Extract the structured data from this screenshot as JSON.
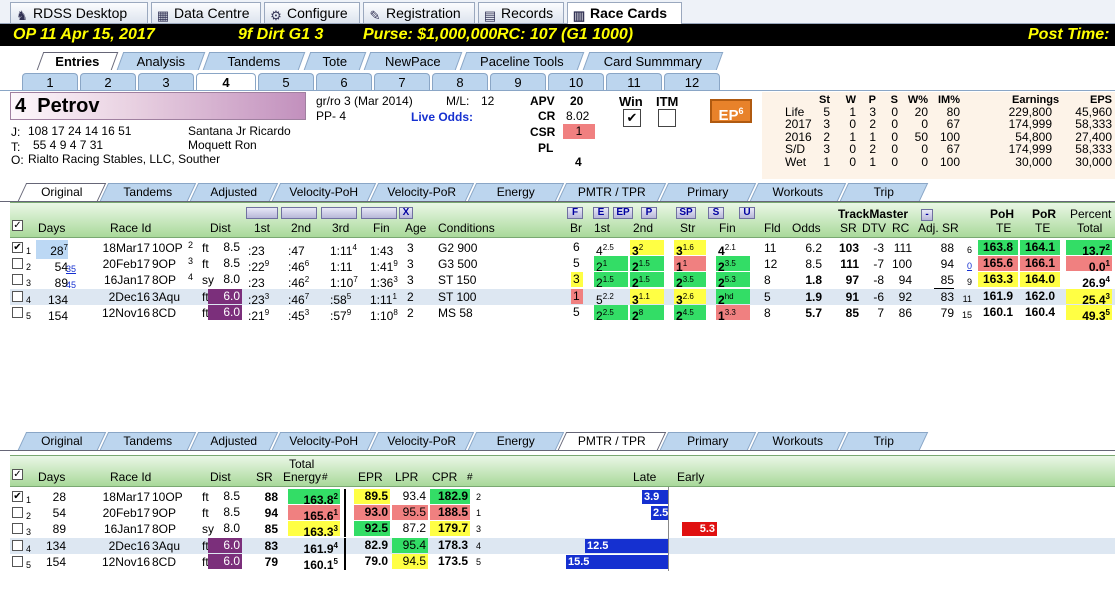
{
  "app_tabs": [
    "RDSS Desktop",
    "Data Centre",
    "Configure",
    "Registration",
    "Records",
    "Race Cards"
  ],
  "app_tab_icons": [
    "horse-icon",
    "grid-icon",
    "gear-icon",
    "key-icon",
    "table-icon",
    "book-icon"
  ],
  "race_header": {
    "race": "OP  11   Apr 15, 2017",
    "info": "9f  Dirt   G1  3",
    "purse": "Purse: $1,000,000",
    "rc": "RC: 107  (G1 1000)",
    "post": "Post Time:"
  },
  "entry_tabs": [
    "Entries",
    "Analysis",
    "Tandems",
    "Tote",
    "NewPace",
    "Paceline Tools",
    "Card Summmary"
  ],
  "post_tabs": [
    "1",
    "2",
    "3",
    "4",
    "5",
    "6",
    "7",
    "8",
    "9",
    "10",
    "11",
    "12"
  ],
  "horse": {
    "post": "4",
    "name": "Petrov",
    "breeding": "gr/ro  3  (Mar 2014)",
    "pp": "PP- 4",
    "ml_label": "M/L:",
    "ml": "12",
    "live_odds": "Live Odds:",
    "jockey_label": "J:",
    "jockey_stats": "108   17   24  14      16    51",
    "jockey": "Santana Jr Ricardo",
    "trainer_label": "T:",
    "trainer_stats": "55    4    9    4       7    31",
    "trainer": "Moquett Ron",
    "owner_label": "O:",
    "owner": "Rialto Racing Stables, LLC, Souther"
  },
  "ratings": {
    "apv_label": "APV",
    "apv": "20",
    "cr_label": "CR",
    "cr": "8.02",
    "csr_label": "CSR",
    "csr": "1",
    "pl_label": "PL",
    "pl": "4",
    "win": "Win",
    "itm": "ITM",
    "win_checked": "✔",
    "ep": "EP",
    "ep_sup": "6"
  },
  "stats": {
    "headers": [
      "St",
      "W",
      "P",
      "S",
      "W%",
      "IM%",
      "Earnings",
      "EPS"
    ],
    "rows": [
      {
        "label": "Life",
        "v": [
          "5",
          "1",
          "3",
          "0",
          "20",
          "80",
          "229,800",
          "45,960"
        ]
      },
      {
        "label": "2017",
        "v": [
          "3",
          "0",
          "2",
          "0",
          "0",
          "67",
          "174,999",
          "58,333"
        ]
      },
      {
        "label": "2016",
        "v": [
          "2",
          "1",
          "1",
          "0",
          "50",
          "100",
          "54,800",
          "27,400"
        ]
      },
      {
        "label": "S/D",
        "v": [
          "3",
          "0",
          "2",
          "0",
          "0",
          "67",
          "174,999",
          "58,333"
        ]
      },
      {
        "label": "Wet",
        "v": [
          "1",
          "0",
          "1",
          "0",
          "0",
          "100",
          "30,000",
          "30,000"
        ]
      }
    ]
  },
  "grid_tabs": [
    "Original",
    "Tandems",
    "Adjusted",
    "Velocity-PoH",
    "Velocity-PoR",
    "Energy",
    "PMTR / TPR",
    "Primary",
    "Workouts",
    "Trip"
  ],
  "top_headers": {
    "days": "Days",
    "race_id": "Race Id",
    "dist": "Dist",
    "f1": "1st",
    "f2": "2nd",
    "f3": "3rd",
    "fin": "Fin",
    "age": "Age",
    "conditions": "Conditions",
    "br": "Br",
    "c1": "1st",
    "c2": "2nd",
    "str": "Str",
    "cfin": "Fin",
    "fld": "Fld",
    "odds": "Odds",
    "trackmaster": "TrackMaster",
    "sr": "SR",
    "dtv": "DTV",
    "rc": "RC",
    "adj_sr": "Adj. SR",
    "poh": "PoH",
    "poh2": "TE",
    "por": "PoR",
    "por2": "TE",
    "pct": "Percent",
    "pct2": "Total",
    "btns": [
      "F",
      "E",
      "EP",
      "P",
      "SP",
      "S",
      "U"
    ],
    "x_btn": "X",
    "minus_btn": "-"
  },
  "top_rows": [
    {
      "n": "1",
      "chk": "✔",
      "days": "28",
      "days_sup": "7",
      "gap": "",
      "date": "18Mar17",
      "trk": "10OP",
      "rn": "2",
      "sfc": "ft",
      "dist": "8.5",
      "f1": ":23",
      "f2": ":47",
      "f3": "1:11",
      "f3s": "4",
      "fin": "1:43",
      "fins": "",
      "age": "3",
      "cond": "G2 900",
      "br": "6",
      "c1": "4",
      "c1s": "2.5",
      "c2": "3",
      "c2s": "2",
      "st": "3",
      "sts": "1.6",
      "cf": "4",
      "cfs": "2.1",
      "fld": "11",
      "odds": "6.2",
      "sr": "103",
      "dtv": "-3",
      "rc": "111",
      "adj": "88",
      "adjs": "6",
      "poh": "163.8",
      "por": "164.1",
      "pct": "13.7",
      "pcts": "2"
    },
    {
      "n": "2",
      "chk": "",
      "days": "54",
      "days_sup": "",
      "gap": "35",
      "date": "20Feb17",
      "trk": "9OP",
      "rn": "3",
      "sfc": "ft",
      "dist": "8.5",
      "f1": ":22",
      "f1s": "9",
      "f2": ":46",
      "f2s": "6",
      "f3": "1:11",
      "f3s": "",
      "fin": "1:41",
      "fins": "9",
      "age": "3",
      "cond": "G3 500",
      "br": "5",
      "c1": "2",
      "c1s": "1",
      "c2": "2",
      "c2s": "1.5",
      "st": "1",
      "sts": "1",
      "cf": "2",
      "cfs": "3.5",
      "fld": "12",
      "odds": "8.5",
      "sr": "111",
      "dtv": "-7",
      "rc": "100",
      "adj": "94",
      "adjs": "0",
      "poh": "165.6",
      "por": "166.1",
      "pct": "0.0",
      "pcts": "1"
    },
    {
      "n": "3",
      "chk": "",
      "days": "89",
      "days_sup": "",
      "gap": "45",
      "date": "16Jan17",
      "trk": "8OP",
      "rn": "4",
      "sfc": "sy",
      "dist": "8.0",
      "f1": ":23",
      "f2": ":46",
      "f2s": "2",
      "f3": "1:10",
      "f3s": "7",
      "fin": "1:36",
      "fins": "3",
      "age": "3",
      "cond": "ST 150",
      "br": "3",
      "c1": "2",
      "c1s": "1.5",
      "c2": "2",
      "c2s": "1.5",
      "st": "2",
      "sts": "3.5",
      "cf": "2",
      "cfs": "5.3",
      "fld": "8",
      "odds": "1.8",
      "sr": "97",
      "dtv": "-8",
      "rc": "94",
      "adj": "85",
      "adjs": "9",
      "poh": "163.3",
      "por": "164.0",
      "pct": "26.9",
      "pcts": "4"
    },
    {
      "n": "4",
      "chk": "",
      "days": "134",
      "days_sup": "",
      "gap": "",
      "date": "2Dec16",
      "trk": "3Aqu",
      "rn": "",
      "sfc": "ft",
      "dist": "6.0",
      "f1": ":23",
      "f1s": "3",
      "f2": ":46",
      "f2s": "7",
      "f3": ":58",
      "f3s": "5",
      "fin": "1:11",
      "fins": "1",
      "age": "2",
      "cond": "ST 100",
      "br": "1",
      "c1": "5",
      "c1s": "2.2",
      "c2": "3",
      "c2s": "1.1",
      "st": "3",
      "sts": "2.6",
      "cf": "2",
      "cfs": "hd",
      "fld": "5",
      "odds": "1.9",
      "sr": "91",
      "dtv": "-6",
      "rc": "92",
      "adj": "83",
      "adjs": "11",
      "poh": "161.9",
      "por": "162.0",
      "pct": "25.4",
      "pcts": "3"
    },
    {
      "n": "5",
      "chk": "",
      "days": "154",
      "days_sup": "",
      "gap": "",
      "date": "12Nov16",
      "trk": "8CD",
      "rn": "",
      "sfc": "ft",
      "dist": "6.0",
      "f1": ":21",
      "f1s": "9",
      "f2": ":45",
      "f2s": "3",
      "f3": ":57",
      "f3s": "9",
      "fin": "1:10",
      "fins": "8",
      "age": "2",
      "cond": "MS 58",
      "br": "5",
      "c1": "2",
      "c1s": "2.5",
      "c2": "2",
      "c2s": "8",
      "st": "2",
      "sts": "4.5",
      "cf": "1",
      "cfs": "3.3",
      "fld": "8",
      "odds": "5.7",
      "sr": "85",
      "dtv": "7",
      "rc": "86",
      "adj": "79",
      "adjs": "15",
      "poh": "160.1",
      "por": "160.4",
      "pct": "49.3",
      "pcts": "5"
    }
  ],
  "bottom_headers": {
    "days": "Days",
    "race_id": "Race Id",
    "dist": "Dist",
    "sr": "SR",
    "te1": "Total",
    "te2": "Energy",
    "hash": "#",
    "epr": "EPR",
    "lpr": "LPR",
    "cpr": "CPR",
    "hash2": "#",
    "late": "Late",
    "early": "Early"
  },
  "bottom_rows": [
    {
      "n": "1",
      "chk": "✔",
      "days": "28",
      "date": "18Mar17",
      "trk": "10OP",
      "sfc": "ft",
      "dist": "8.5",
      "sr": "88",
      "te": "163.8",
      "tes": "2",
      "epr": "89.5",
      "lpr": "93.4",
      "cpr": "182.9",
      "cprn": "2",
      "late": "3.9",
      "early": ""
    },
    {
      "n": "2",
      "chk": "",
      "days": "54",
      "date": "20Feb17",
      "trk": "9OP",
      "sfc": "ft",
      "dist": "8.5",
      "sr": "94",
      "te": "165.6",
      "tes": "1",
      "epr": "93.0",
      "lpr": "95.5",
      "cpr": "188.5",
      "cprn": "1",
      "late": "2.5",
      "early": ""
    },
    {
      "n": "3",
      "chk": "",
      "days": "89",
      "date": "16Jan17",
      "trk": "8OP",
      "sfc": "sy",
      "dist": "8.0",
      "sr": "85",
      "te": "163.3",
      "tes": "3",
      "epr": "92.5",
      "lpr": "87.2",
      "cpr": "179.7",
      "cprn": "3",
      "late": "",
      "early": "5.3"
    },
    {
      "n": "4",
      "chk": "",
      "days": "134",
      "date": "2Dec16",
      "trk": "3Aqu",
      "sfc": "ft",
      "dist": "6.0",
      "sr": "83",
      "te": "161.9",
      "tes": "4",
      "epr": "82.9",
      "lpr": "95.4",
      "cpr": "178.3",
      "cprn": "4",
      "late": "12.5",
      "early": ""
    },
    {
      "n": "5",
      "chk": "",
      "days": "154",
      "date": "12Nov16",
      "trk": "8CD",
      "sfc": "ft",
      "dist": "6.0",
      "sr": "79",
      "te": "160.1",
      "tes": "5",
      "epr": "79.0",
      "lpr": "94.5",
      "cpr": "173.5",
      "cprn": "5",
      "late": "15.5",
      "early": ""
    }
  ]
}
